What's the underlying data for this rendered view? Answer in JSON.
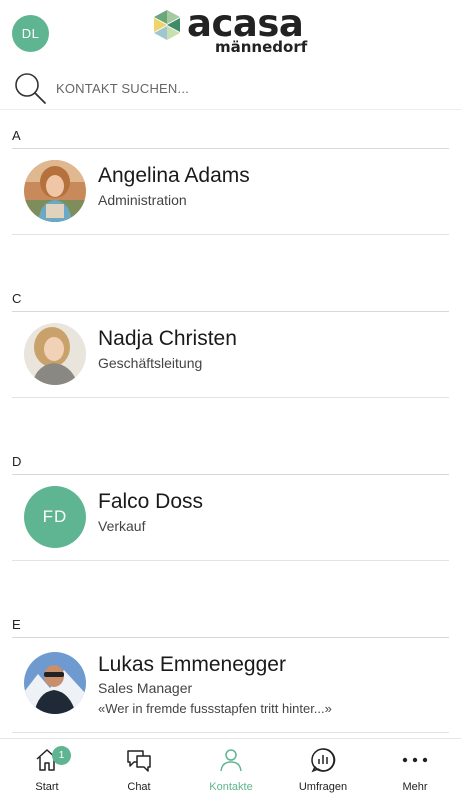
{
  "header": {
    "user_initials": "DL",
    "logo_word": "acasa",
    "logo_sub": "männedorf"
  },
  "search": {
    "placeholder": "KONTAKT SUCHEN..."
  },
  "sections": [
    {
      "letter": "A",
      "contacts": [
        {
          "name": "Angelina Adams",
          "role": "Administration",
          "avatar": "photo-woman-outdoor"
        }
      ]
    },
    {
      "letter": "C",
      "contacts": [
        {
          "name": "Nadja Christen",
          "role": "Geschäftsleitung",
          "avatar": "photo-woman-blonde"
        }
      ]
    },
    {
      "letter": "D",
      "contacts": [
        {
          "name": "Falco Doss",
          "role": "Verkauf",
          "initials": "FD"
        }
      ]
    },
    {
      "letter": "E",
      "contacts": [
        {
          "name": "Lukas Emmenegger",
          "role": "Sales Manager",
          "status": "«Wer in fremde fussstapfen tritt hinter...»",
          "avatar": "photo-man-mountain"
        }
      ]
    }
  ],
  "nav": {
    "items": [
      {
        "label": "Start",
        "icon": "home-icon",
        "badge": "1"
      },
      {
        "label": "Chat",
        "icon": "chat-icon"
      },
      {
        "label": "Kontakte",
        "icon": "person-icon",
        "active": true
      },
      {
        "label": "Umfragen",
        "icon": "poll-icon"
      },
      {
        "label": "Mehr",
        "icon": "more-icon"
      }
    ]
  },
  "colors": {
    "accent": "#5fb591",
    "text": "#1a1a1a",
    "divider": "#e3e3e3"
  }
}
